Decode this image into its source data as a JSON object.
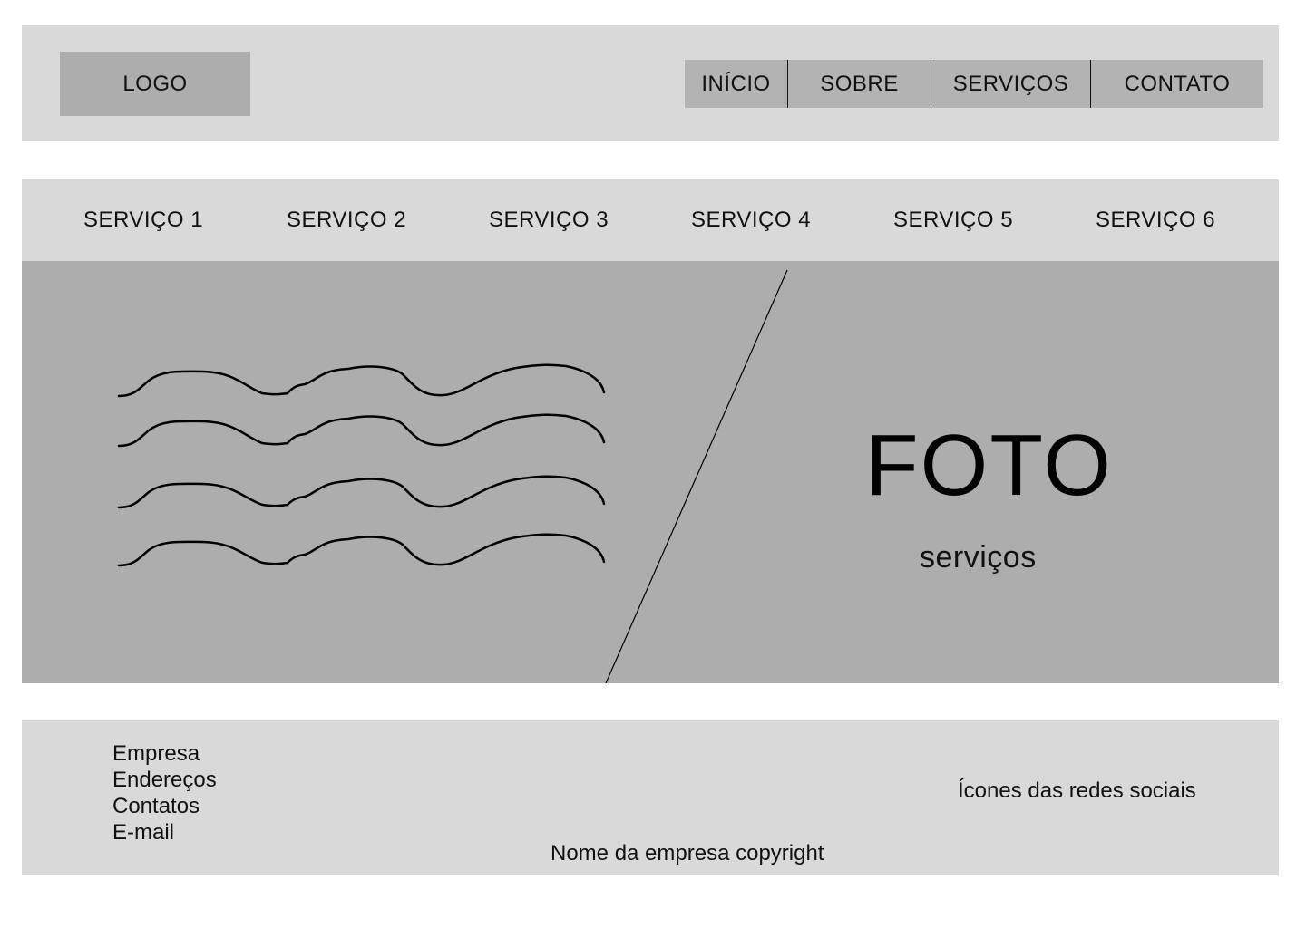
{
  "header": {
    "logo": "LOGO",
    "nav": [
      "INÍCIO",
      "SOBRE",
      "SERVIÇOS",
      "CONTATO"
    ]
  },
  "services": [
    "SERVIÇO 1",
    "SERVIÇO 2",
    "SERVIÇO 3",
    "SERVIÇO 4",
    "SERVIÇO 5",
    "SERVIÇO 6"
  ],
  "hero": {
    "title": "FOTO",
    "subtitle": "serviços"
  },
  "footer": {
    "links": [
      "Empresa",
      "Endereços",
      "Contatos",
      "E-mail"
    ],
    "social": "Ícones das redes sociais",
    "copyright": "Nome da empresa copyright"
  },
  "colors": {
    "light_panel": "#d9d9d9",
    "mid_panel": "#adadad",
    "nav_bg": "#b3b3b3",
    "text": "#111111"
  }
}
